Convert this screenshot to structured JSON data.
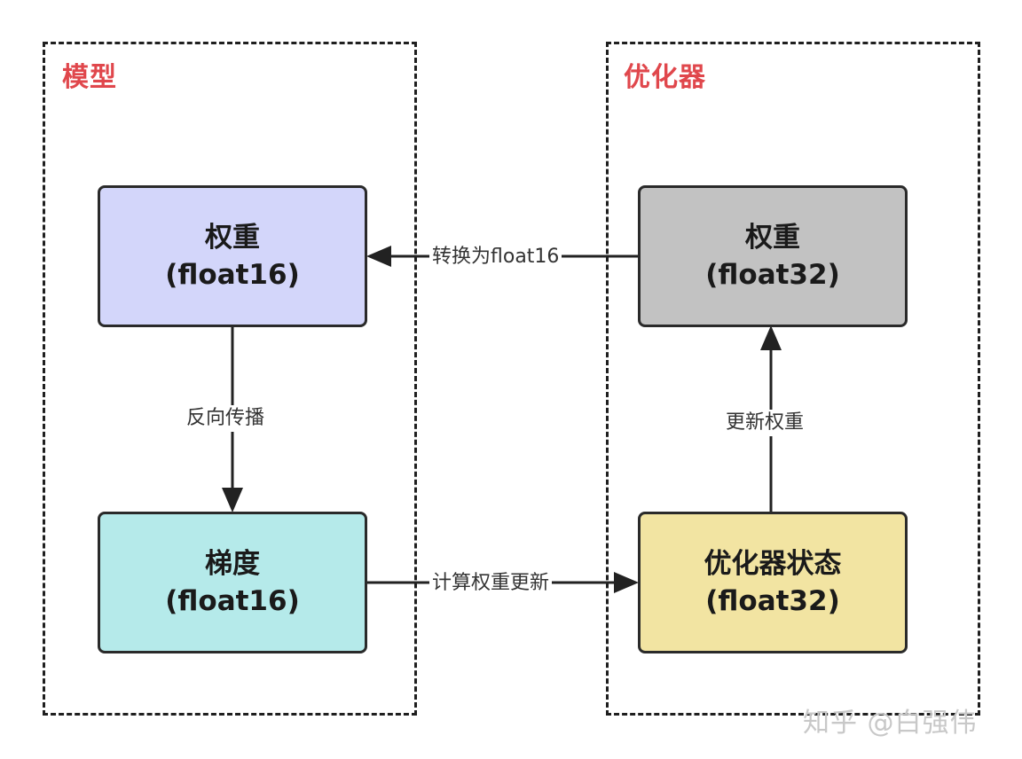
{
  "groups": {
    "model": {
      "title": "模型"
    },
    "optimizer": {
      "title": "优化器"
    }
  },
  "nodes": {
    "weight_fp16": {
      "title": "权重",
      "dtype": "(float16)",
      "color": "#d3d6fa"
    },
    "gradient_fp16": {
      "title": "梯度",
      "dtype": "(float16)",
      "color": "#b5eaea"
    },
    "weight_fp32": {
      "title": "权重",
      "dtype": "(float32)",
      "color": "#c2c2c2"
    },
    "optimizer_state_fp32": {
      "title": "优化器状态",
      "dtype": "(float32)",
      "color": "#f2e4a2"
    }
  },
  "edges": {
    "convert": {
      "label": "转换为float16"
    },
    "backprop": {
      "label": "反向传播"
    },
    "update_weight": {
      "label": "更新权重"
    },
    "compute_update": {
      "label": "计算权重更新"
    }
  },
  "watermark": {
    "text": "知乎 @白强伟"
  }
}
